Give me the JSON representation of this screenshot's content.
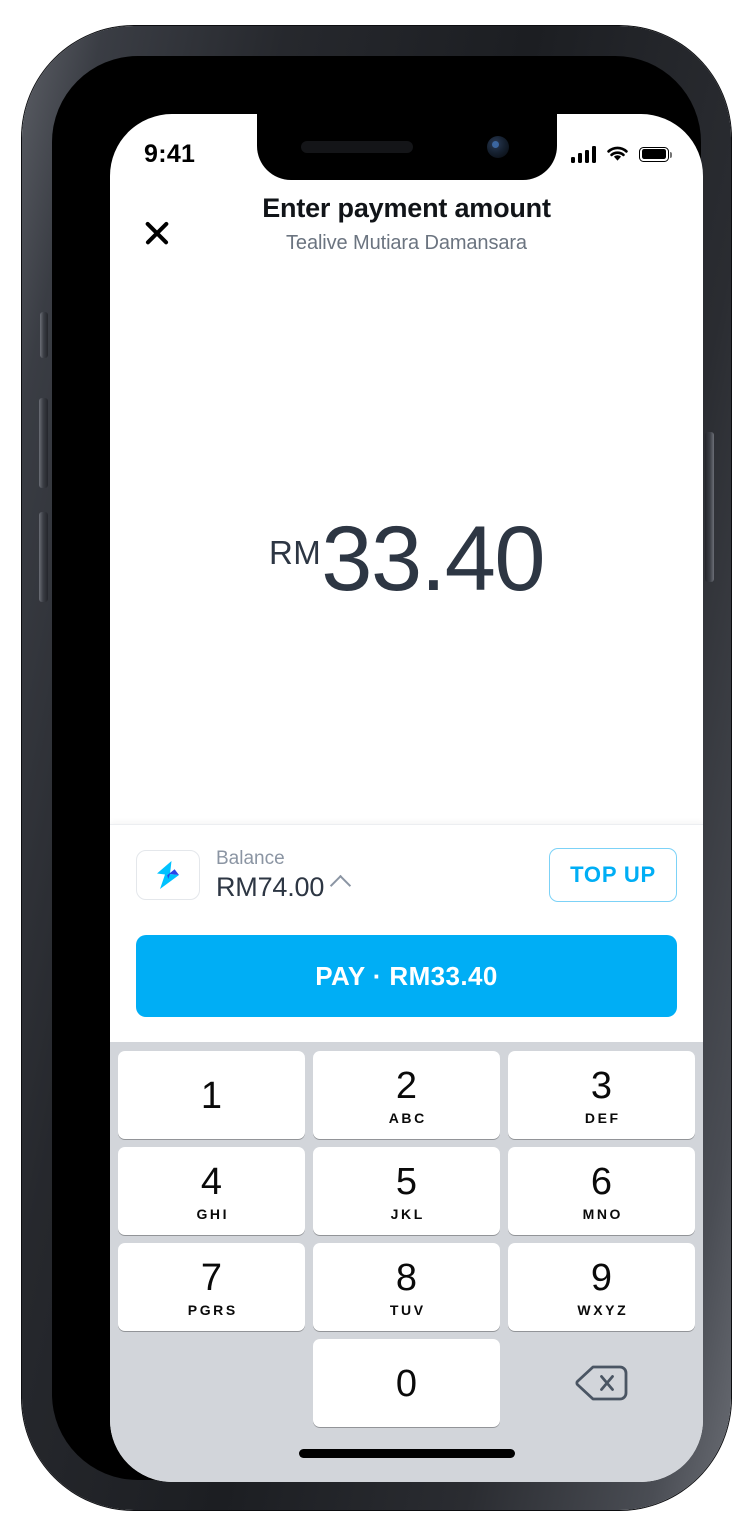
{
  "status_bar": {
    "time": "9:41",
    "signal_icon": "cellular-signal-icon",
    "wifi_icon": "wifi-icon",
    "battery_icon": "battery-full-icon"
  },
  "header": {
    "close_icon": "close-icon",
    "title": "Enter payment amount",
    "merchant": "Tealive Mutiara Damansara"
  },
  "amount": {
    "currency": "RM",
    "value": "33.40"
  },
  "balance": {
    "wallet_icon": "lightning-bolt-icon",
    "label": "Balance",
    "value": "RM74.00",
    "expand_icon": "chevron-up-icon",
    "topup_label": "TOP UP"
  },
  "pay": {
    "label": "PAY · RM33.40"
  },
  "keypad": {
    "rows": [
      [
        {
          "num": "1",
          "sub": ""
        },
        {
          "num": "2",
          "sub": "ABC"
        },
        {
          "num": "3",
          "sub": "DEF"
        }
      ],
      [
        {
          "num": "4",
          "sub": "GHI"
        },
        {
          "num": "5",
          "sub": "JKL"
        },
        {
          "num": "6",
          "sub": "MNO"
        }
      ],
      [
        {
          "num": "7",
          "sub": "PGRS"
        },
        {
          "num": "8",
          "sub": "TUV"
        },
        {
          "num": "9",
          "sub": "WXYZ"
        }
      ]
    ],
    "zero": {
      "num": "0",
      "sub": ""
    },
    "backspace_icon": "backspace-delete-icon"
  },
  "colors": {
    "accent_blue": "#00aef5",
    "topup_border": "#7cd2f7",
    "text_dark": "#2d3643",
    "text_muted": "#8b95a3",
    "keypad_bg": "#d2d5da",
    "bolt_cyan": "#00c2ff",
    "bolt_blue": "#2b44e8"
  }
}
